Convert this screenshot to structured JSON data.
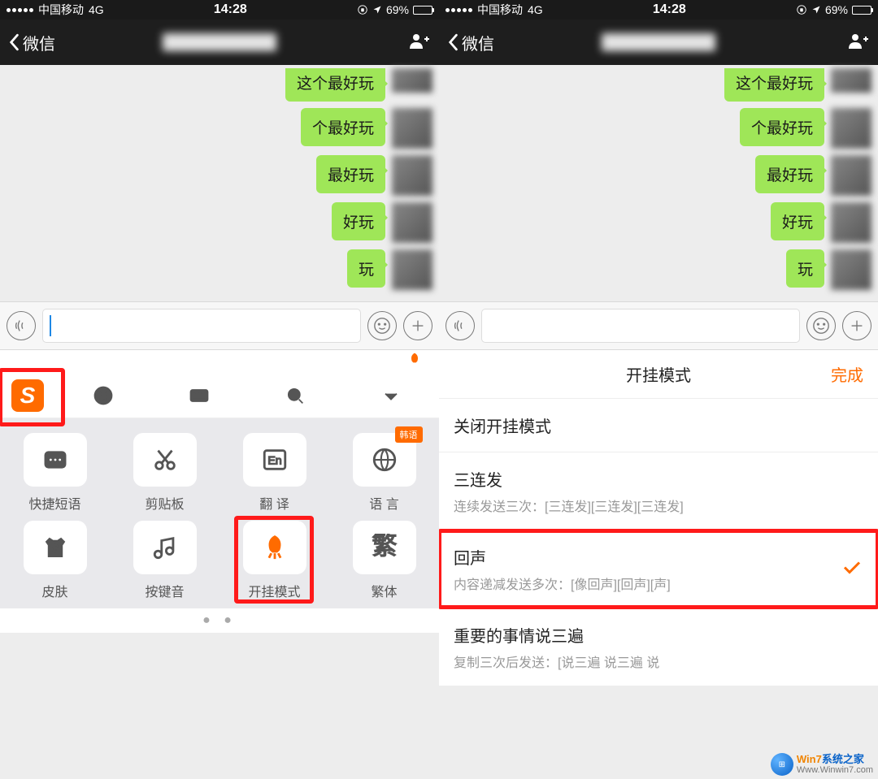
{
  "status": {
    "carrier": "中国移动",
    "network": "4G",
    "time": "14:28",
    "battery_pct": "69%"
  },
  "nav": {
    "back_label": "微信"
  },
  "messages": [
    {
      "text": "这个最好玩",
      "partial_top": true
    },
    {
      "text": "个最好玩"
    },
    {
      "text": "最好玩"
    },
    {
      "text": "好玩"
    },
    {
      "text": "玩"
    }
  ],
  "keyboard": {
    "tools": [
      {
        "id": "quick-phrase",
        "label": "快捷短语",
        "icon": "phrase"
      },
      {
        "id": "clipboard",
        "label": "剪贴板",
        "icon": "scissors"
      },
      {
        "id": "translate",
        "label": "翻 译",
        "icon": "translate"
      },
      {
        "id": "language",
        "label": "语 言",
        "icon": "globe",
        "badge": "韩语"
      },
      {
        "id": "skin",
        "label": "皮肤",
        "icon": "shirt"
      },
      {
        "id": "key-sound",
        "label": "按键音",
        "icon": "music"
      },
      {
        "id": "cheat-mode",
        "label": "开挂模式",
        "icon": "rocket",
        "active": true,
        "highlight": true
      },
      {
        "id": "traditional",
        "label": "繁体",
        "icon": "traditional"
      }
    ],
    "traditional_glyph": "繁"
  },
  "settings": {
    "title": "开挂模式",
    "done": "完成",
    "items": [
      {
        "title": "关闭开挂模式"
      },
      {
        "title": "三连发",
        "sub": "连续发送三次：[三连发][三连发][三连发]"
      },
      {
        "title": "回声",
        "sub": "内容递减发送多次：[像回声][回声][声]",
        "checked": true,
        "highlight": true
      },
      {
        "title": "重要的事情说三遍",
        "sub": "复制三次后发送：[说三遍 说三遍 说"
      }
    ]
  },
  "watermark": {
    "brand_prefix": "Win7",
    "brand_suffix": "系统之家",
    "url": "Www.Winwin7.com"
  }
}
